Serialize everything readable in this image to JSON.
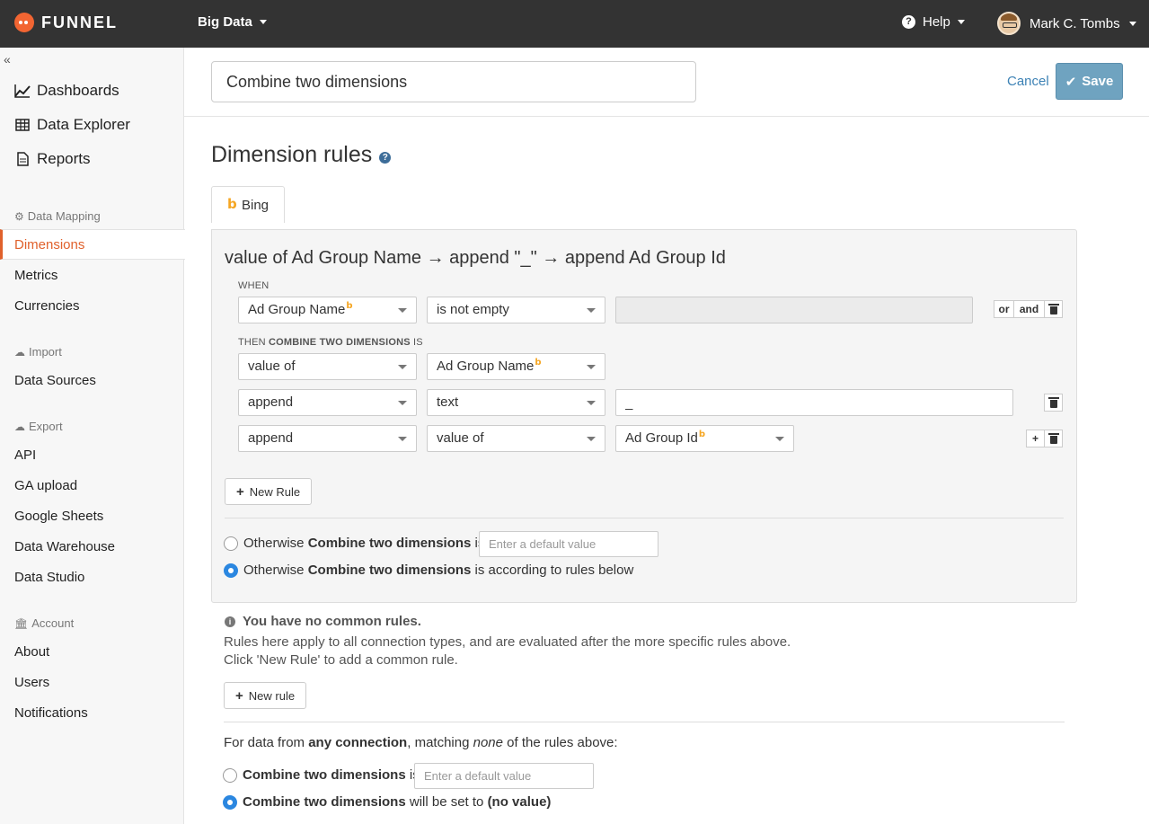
{
  "topbar": {
    "logo_text": "FUNNEL",
    "workspace": "Big Data",
    "help": "Help",
    "user": "Mark C. Tombs"
  },
  "sidebar": {
    "collapse": "«",
    "main": [
      "Dashboards",
      "Data Explorer",
      "Reports"
    ],
    "sections": [
      {
        "head": "Data Mapping",
        "items": [
          "Dimensions",
          "Metrics",
          "Currencies"
        ]
      },
      {
        "head": "Import",
        "items": [
          "Data Sources"
        ]
      },
      {
        "head": "Export",
        "items": [
          "API",
          "GA upload",
          "Google Sheets",
          "Data Warehouse",
          "Data Studio"
        ]
      },
      {
        "head": "Account",
        "items": [
          "About",
          "Users",
          "Notifications"
        ]
      }
    ],
    "active": "Dimensions"
  },
  "header": {
    "title_value": "Combine two dimensions",
    "cancel": "Cancel",
    "save": "Save"
  },
  "main": {
    "heading": "Dimension rules",
    "tab": "Bing",
    "rule_title": "value of Ad Group Name → append \"_\" → append Ad Group Id",
    "when_label": "When",
    "then_label_pre": "Then ",
    "then_label_bold": "Combine two dimensions",
    "then_label_post": " is",
    "condition": {
      "field": "Ad Group Name",
      "operator": "is not empty"
    },
    "or": "or",
    "and": "and",
    "rows": [
      {
        "op": "value of",
        "source": "Ad Group Name"
      },
      {
        "op": "append",
        "source": "text",
        "value": "_"
      },
      {
        "op": "append",
        "source": "value of",
        "field": "Ad Group Id"
      }
    ],
    "new_rule": "New Rule",
    "otherwise1_pre": "Otherwise ",
    "otherwise1_bold": "Combine two dimensions",
    "otherwise1_post": " is",
    "otherwise_placeholder": "Enter a default value",
    "otherwise2_pre": "Otherwise ",
    "otherwise2_bold": "Combine two dimensions",
    "otherwise2_post": " is according to rules below"
  },
  "common": {
    "title": "You have no common rules.",
    "line1": "Rules here apply to all connection types, and are evaluated after the more specific rules above.",
    "line2": "Click 'New Rule' to add a common rule.",
    "new_rule": "New rule"
  },
  "footer": {
    "para_pre": "For data from ",
    "para_bold": "any connection",
    "para_mid": ", matching ",
    "para_em": "none",
    "para_post": " of the rules above:",
    "opt1_bold": "Combine two dimensions",
    "opt1_post": " is",
    "placeholder": "Enter a default value",
    "opt2_bold": "Combine two dimensions",
    "opt2_mid": " will be set to ",
    "opt2_bold2": "(no value)"
  },
  "colors": {
    "accent": "#e0612c",
    "topbar": "#333333",
    "save": "#6fa3c0",
    "link": "#3d82b5",
    "radio": "#2b87e0"
  }
}
